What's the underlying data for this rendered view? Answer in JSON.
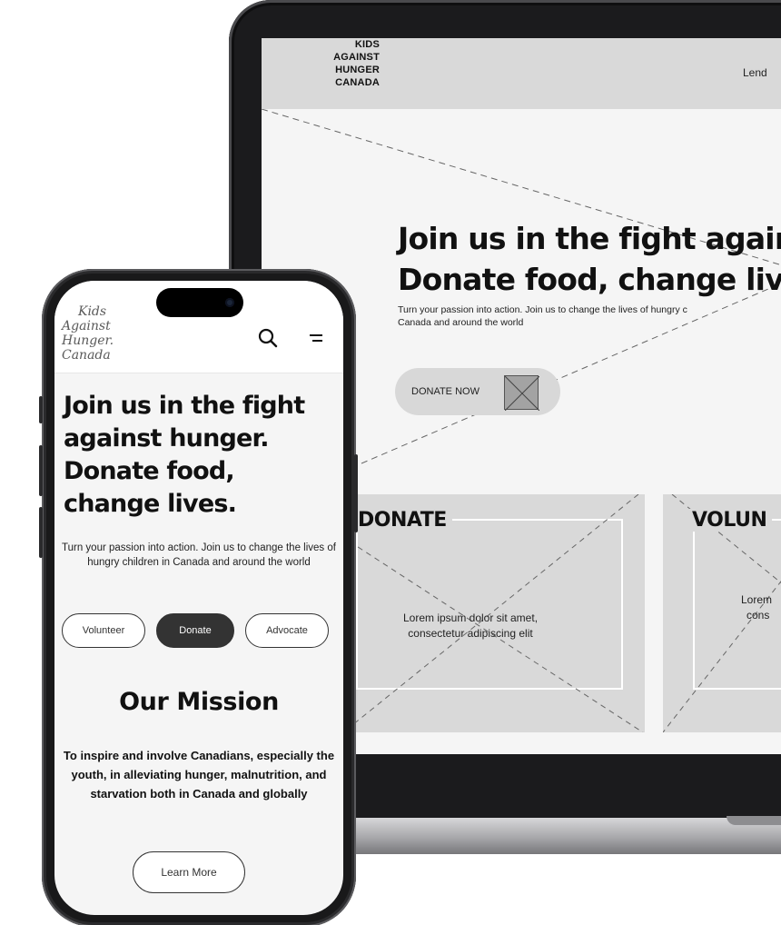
{
  "laptop": {
    "logo_lines": [
      "KIDS",
      "AGAINST",
      "HUNGER",
      "CANADA"
    ],
    "nav_partial": "Lend",
    "hero_line1": "Join us in the fight against",
    "hero_line2": "Donate food, change lives.",
    "hero_sub_line1": "Turn your passion into action. Join us to change the lives of hungry c",
    "hero_sub_line2": "Canada and around the world",
    "donate_button": "DONATE NOW",
    "cards": [
      {
        "title": "DONATE",
        "text_line1": "Lorem ipsum dolor sit amet,",
        "text_line2": "consectetur adipiscing elit"
      },
      {
        "title": "VOLUN",
        "text_line1": "Lorem",
        "text_line2": "cons"
      }
    ]
  },
  "phone": {
    "logo_lines": [
      "Kids",
      "Against",
      "Hunger.",
      "Canada"
    ],
    "hero_title": "Join us in the fight against hunger. Donate food, change lives.",
    "hero_sub": "Turn your passion into action. Join us to change the lives of hungry children in Canada and around the world",
    "pills": [
      {
        "label": "Volunteer",
        "active": false
      },
      {
        "label": "Donate",
        "active": true
      },
      {
        "label": "Advocate",
        "active": false
      }
    ],
    "mission_heading": "Our Mission",
    "mission_text": "To inspire and involve Canadians, especially the youth, in alleviating hunger, malnutrition, and starvation both in Canada and globally",
    "learn_more": "Learn More"
  },
  "icons": {
    "phone_search": "search-icon",
    "phone_menu": "menu-icon",
    "laptop_donate_image": "image-placeholder-icon"
  }
}
